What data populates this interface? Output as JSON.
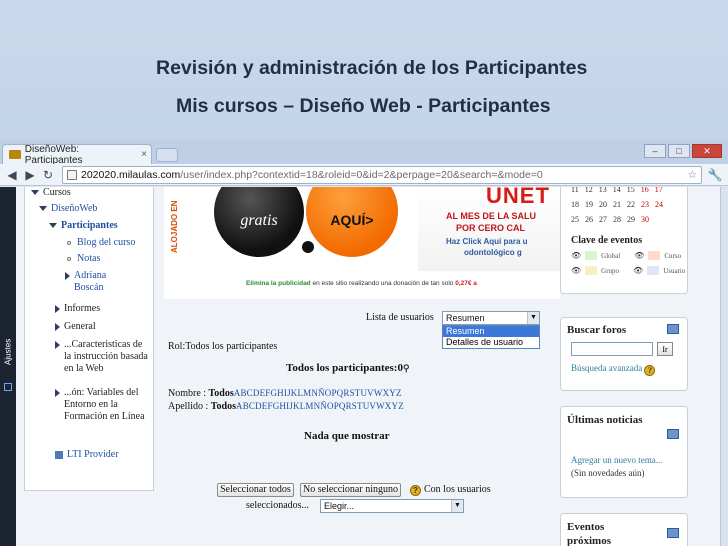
{
  "slide": {
    "title": "Revisión y administración de los Participantes",
    "subtitle": "Mis cursos – Diseño Web -  Participantes"
  },
  "browser": {
    "tab_title": "DiseñoWeb: Participantes",
    "tab_close": "×",
    "url_domain": "202020.milaulas.com",
    "url_path": "/user/index.php?contextid=18&roleid=0&id=2&perpage=20&search=&mode=0",
    "window_controls": [
      "–",
      "□",
      "✕"
    ],
    "nav_back": "◀",
    "nav_forward": "▶",
    "nav_reload": "↻",
    "star": "☆",
    "wrench": "🔧"
  },
  "sidebar_strip": {
    "label": "Ajustes"
  },
  "nav": {
    "items": [
      {
        "label": "Cursos"
      },
      {
        "label": "DiseñoWeb"
      },
      {
        "label": "Participantes"
      },
      {
        "label": "Blog del curso"
      },
      {
        "label": "Notas"
      },
      {
        "label": "Adriana Boscán"
      },
      {
        "label": "Informes"
      },
      {
        "label": "General"
      },
      {
        "label": "...Caracteristicas de la instrucción basada en la Web"
      },
      {
        "label": "...ón: Variables del Entorno en la Formación en Línea"
      },
      {
        "label": "LTI Provider"
      }
    ]
  },
  "ad": {
    "side_text": "ALOJADO EN",
    "gratis": "gratis",
    "aqui": "AQUÍ>",
    "brand": "UNET",
    "promo_line1": "AL MES DE LA SALU",
    "promo_line2": "POR CERO CAL",
    "promo_line3": "Haz Click Aquí para u",
    "promo_line4": "odontológico g",
    "elimina_bold": "Elimina la publicidad",
    "elimina_text": " en este sitio realizando una donación de tan solo ",
    "elimina_amount": "0,27€ a"
  },
  "participants": {
    "list_label": "Lista de usuarios",
    "list_value": "Resumen",
    "list_options": [
      "Resumen",
      "Detalles de usuario"
    ],
    "role_label": "Rol:Todos los participantes",
    "all_label": "Todos los participantes:0",
    "name_label": "Nombre : ",
    "name_all": "Todos",
    "lastname_label": "Apellido : ",
    "lastname_all": "Todos",
    "letters": "ABCDEFGHIJKLMNÑOPQRSTUVWXYZ",
    "nothing": "Nada que mostrar",
    "select_all": "Seleccionar todos",
    "select_none": "No seleccionar ninguno",
    "with_users": "Con los usuarios",
    "selected": "seleccionados...",
    "choose": "Elegir..."
  },
  "calendar": {
    "rows": [
      [
        "11",
        "12",
        "13",
        "14",
        "15",
        "16",
        "17"
      ],
      [
        "18",
        "19",
        "20",
        "21",
        "22",
        "23",
        "24"
      ],
      [
        "25",
        "26",
        "27",
        "28",
        "29",
        "30"
      ]
    ],
    "events_title": "Clave de eventos",
    "legend": [
      "Global",
      "Curso",
      "Grupo",
      "Usuario"
    ]
  },
  "search_forums": {
    "title": "Buscar foros",
    "go": "Ir",
    "advanced": "Búsqueda avanzada"
  },
  "news": {
    "title": "Últimas noticias",
    "add": "Agregar un nuevo tema...",
    "none": "(Sin novedades aún)"
  },
  "events": {
    "title": "Eventos próximos"
  },
  "colors": {
    "link": "#1f4fa0",
    "accent_orange": "#f26a00",
    "brand_red": "#d71c16",
    "selected_blue": "#3d78d8"
  }
}
